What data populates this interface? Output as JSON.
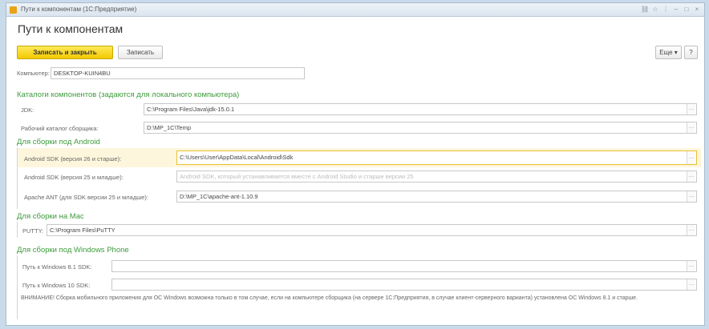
{
  "window": {
    "title": "Пути к компонентам (1С:Предприятие)"
  },
  "heading": "Пути к компонентам",
  "toolbar": {
    "save_close": "Записать и закрыть",
    "save": "Записать",
    "more": "Еще",
    "more_arrow": "▾",
    "help": "?"
  },
  "computer": {
    "label": "Компьютер:",
    "value": "DESKTOP-KUIN4BU"
  },
  "section_catalogs": {
    "title": "Каталоги компонентов (задаются для локального компьютера)",
    "jdk_label": "JDK:",
    "jdk_value": "C:\\Program Files\\Java\\jdk-15.0.1",
    "workdir_label": "Рабочий каталог сборщика:",
    "workdir_value": "D:\\MP_1C\\Temp"
  },
  "section_android": {
    "title": "Для сборки под Android",
    "sdk26_label": "Android SDK (версия 26 и старше):",
    "sdk26_value": "C:\\Users\\User\\AppData\\Local\\Android\\Sdk",
    "sdk25_label": "Android SDK (версия 25 и младше):",
    "sdk25_placeholder": "Android SDK, который устанавливается вместе с Android Studio и старше версии 25",
    "ant_label": "Apache ANT (для SDK версии 25 и младше):",
    "ant_value": "D:\\MP_1C\\apache-ant-1.10.9"
  },
  "section_mac": {
    "title": "Для сборки на Mac",
    "putty_label": "PUTTY:",
    "putty_value": "C:\\Program Files\\PuTTY"
  },
  "section_wp": {
    "title": "Для сборки под Windows Phone",
    "sdk81_label": "Путь к Windows 8.1 SDK:",
    "sdk81_value": "",
    "sdk10_label": "Путь к Windows 10 SDK:",
    "sdk10_value": "",
    "warning": "ВНИМАНИЕ! Сборка мобильного приложения для ОС Windows возможна только в том случае, если на компьютере сборщика (на сервере 1С:Предприятия, в случае клиент-серверного варианта) установлена ОС Windows 8.1 и старше."
  },
  "icons": {
    "select": "…",
    "close": "×"
  }
}
